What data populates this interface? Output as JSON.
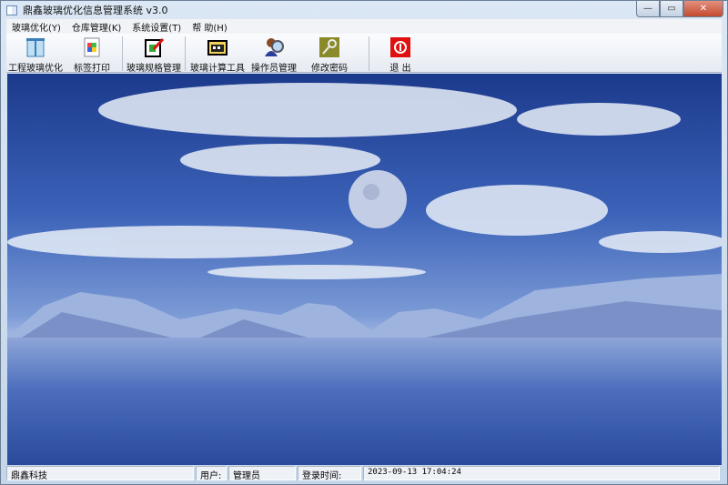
{
  "window": {
    "title": "鼎鑫玻璃优化信息管理系统 v3.0",
    "min": "—",
    "max": "▭",
    "close": "✕"
  },
  "menu": [
    "玻璃优化(Y)",
    "仓库管理(K)",
    "系统设置(T)",
    "帮 助(H)"
  ],
  "toolbar": [
    {
      "label": "工程玻璃优化",
      "icon": "book-icon"
    },
    {
      "label": "标签打印",
      "icon": "print-doc-icon"
    },
    {
      "label": "玻璃规格管理",
      "icon": "edit-spec-icon"
    },
    {
      "label": "玻璃计算工具",
      "icon": "calculator-icon"
    },
    {
      "label": "操作员管理",
      "icon": "user-search-icon"
    },
    {
      "label": "修改密码",
      "icon": "key-icon"
    },
    {
      "label": "退 出",
      "icon": "exit-icon"
    }
  ],
  "status": {
    "company": "鼎鑫科技",
    "user_label": "用户:",
    "user": "管理员",
    "login_label": "登录时间:",
    "login_time": "2023-09-13 17:04:24"
  }
}
